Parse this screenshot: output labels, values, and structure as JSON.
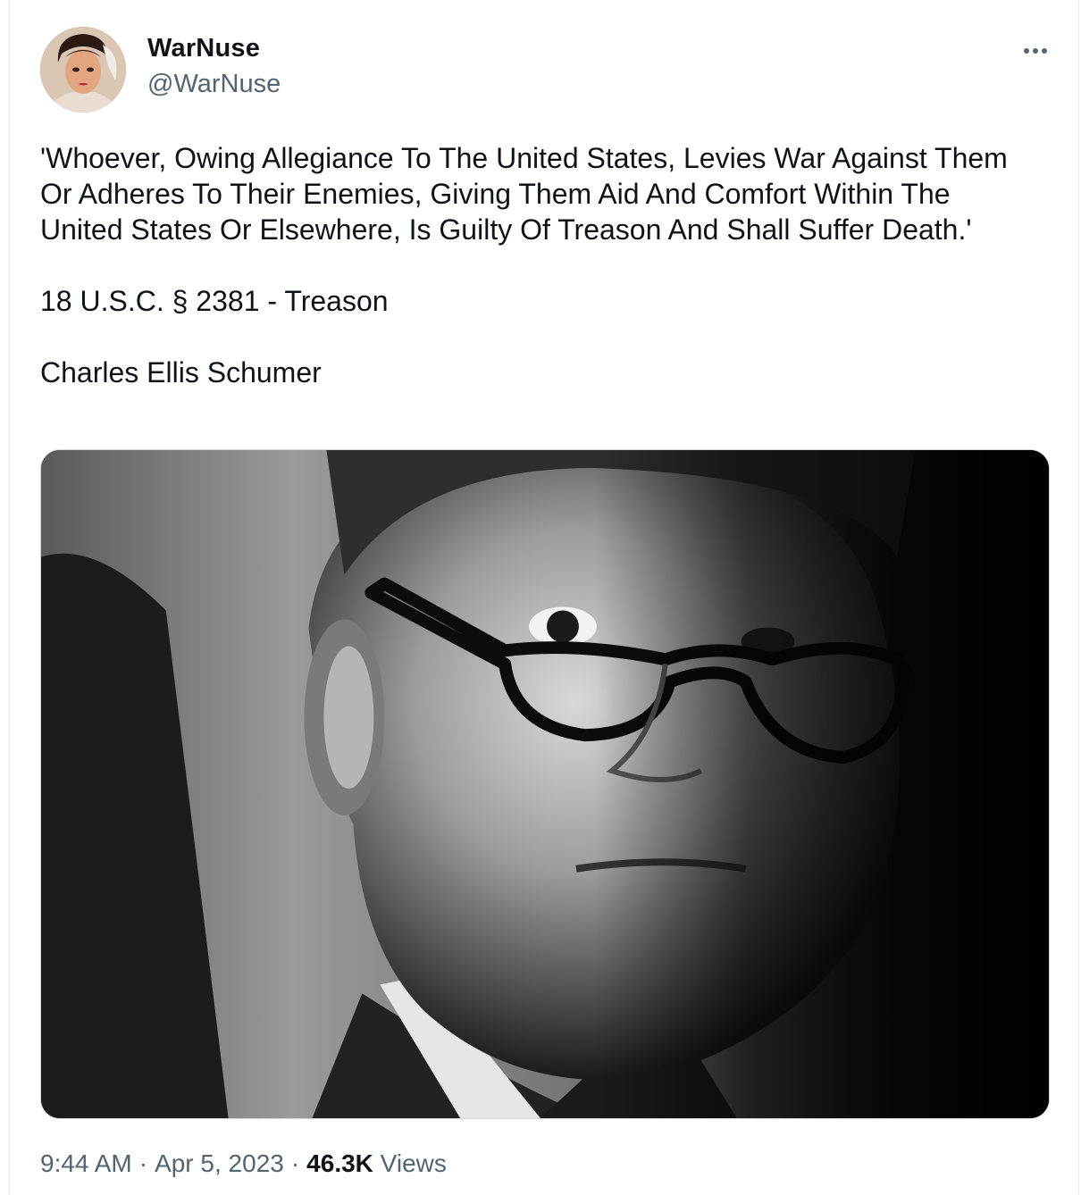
{
  "author": {
    "name": "WarNuse",
    "handle": "@WarNuse"
  },
  "tweet": {
    "text": "'Whoever, Owing Allegiance To The United States, Levies War Against Them Or Adheres To Their Enemies, Giving Them Aid And Comfort Within The United States Or Elsewhere, Is Guilty Of Treason And Shall Suffer Death.'\n\n18 U.S.C. § 2381 - Treason\n\nCharles Ellis Schumer"
  },
  "meta": {
    "time": "9:44 AM",
    "separator": "·",
    "date": "Apr 5, 2023",
    "views_count": "46.3K",
    "views_label": "Views"
  },
  "icons": {
    "more": "more-horizontal-icon"
  },
  "colors": {
    "text": "#0f1419",
    "secondary": "#536471",
    "border": "#cfd9de"
  }
}
